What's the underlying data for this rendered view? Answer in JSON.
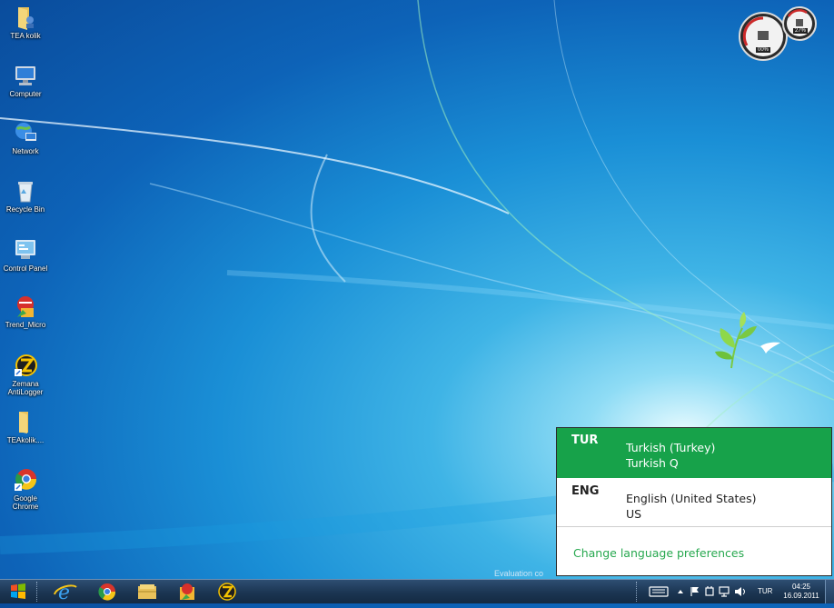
{
  "desktop": {
    "icons": [
      {
        "label": "TEA kolik",
        "icon": "folder-user-icon"
      },
      {
        "label": "Computer",
        "icon": "computer-icon"
      },
      {
        "label": "Network",
        "icon": "network-icon"
      },
      {
        "label": "Recycle Bin",
        "icon": "recycle-bin-icon"
      },
      {
        "label": "Control Panel",
        "icon": "control-panel-icon"
      },
      {
        "label": "Trend_Micro",
        "icon": "trend-micro-icon"
      },
      {
        "label": "Zemana AntiLogger",
        "icon": "zemana-icon"
      },
      {
        "label": "TEAkolik....",
        "icon": "folder-icon"
      },
      {
        "label": "Google Chrome",
        "icon": "chrome-icon"
      }
    ],
    "watermark": "Evaluation co"
  },
  "gadget": {
    "cpu_percent": "00%",
    "memory_percent": "27%"
  },
  "language_popup": {
    "items": [
      {
        "code": "TUR",
        "name": "Turkish (Turkey)",
        "layout": "Turkish Q",
        "selected": true
      },
      {
        "code": "ENG",
        "name": "English (United States)",
        "layout": "US",
        "selected": false
      }
    ],
    "change_link": "Change language preferences",
    "selected_color": "#17a24a",
    "link_color": "#27a84f"
  },
  "taskbar": {
    "pinned": [
      "windows-start-icon",
      "internet-explorer-icon",
      "chrome-icon",
      "explorer-icon",
      "trend-micro-icon",
      "zemana-icon"
    ],
    "tray": {
      "language": "TUR",
      "time": "04:25",
      "date": "16.09.2011"
    }
  }
}
